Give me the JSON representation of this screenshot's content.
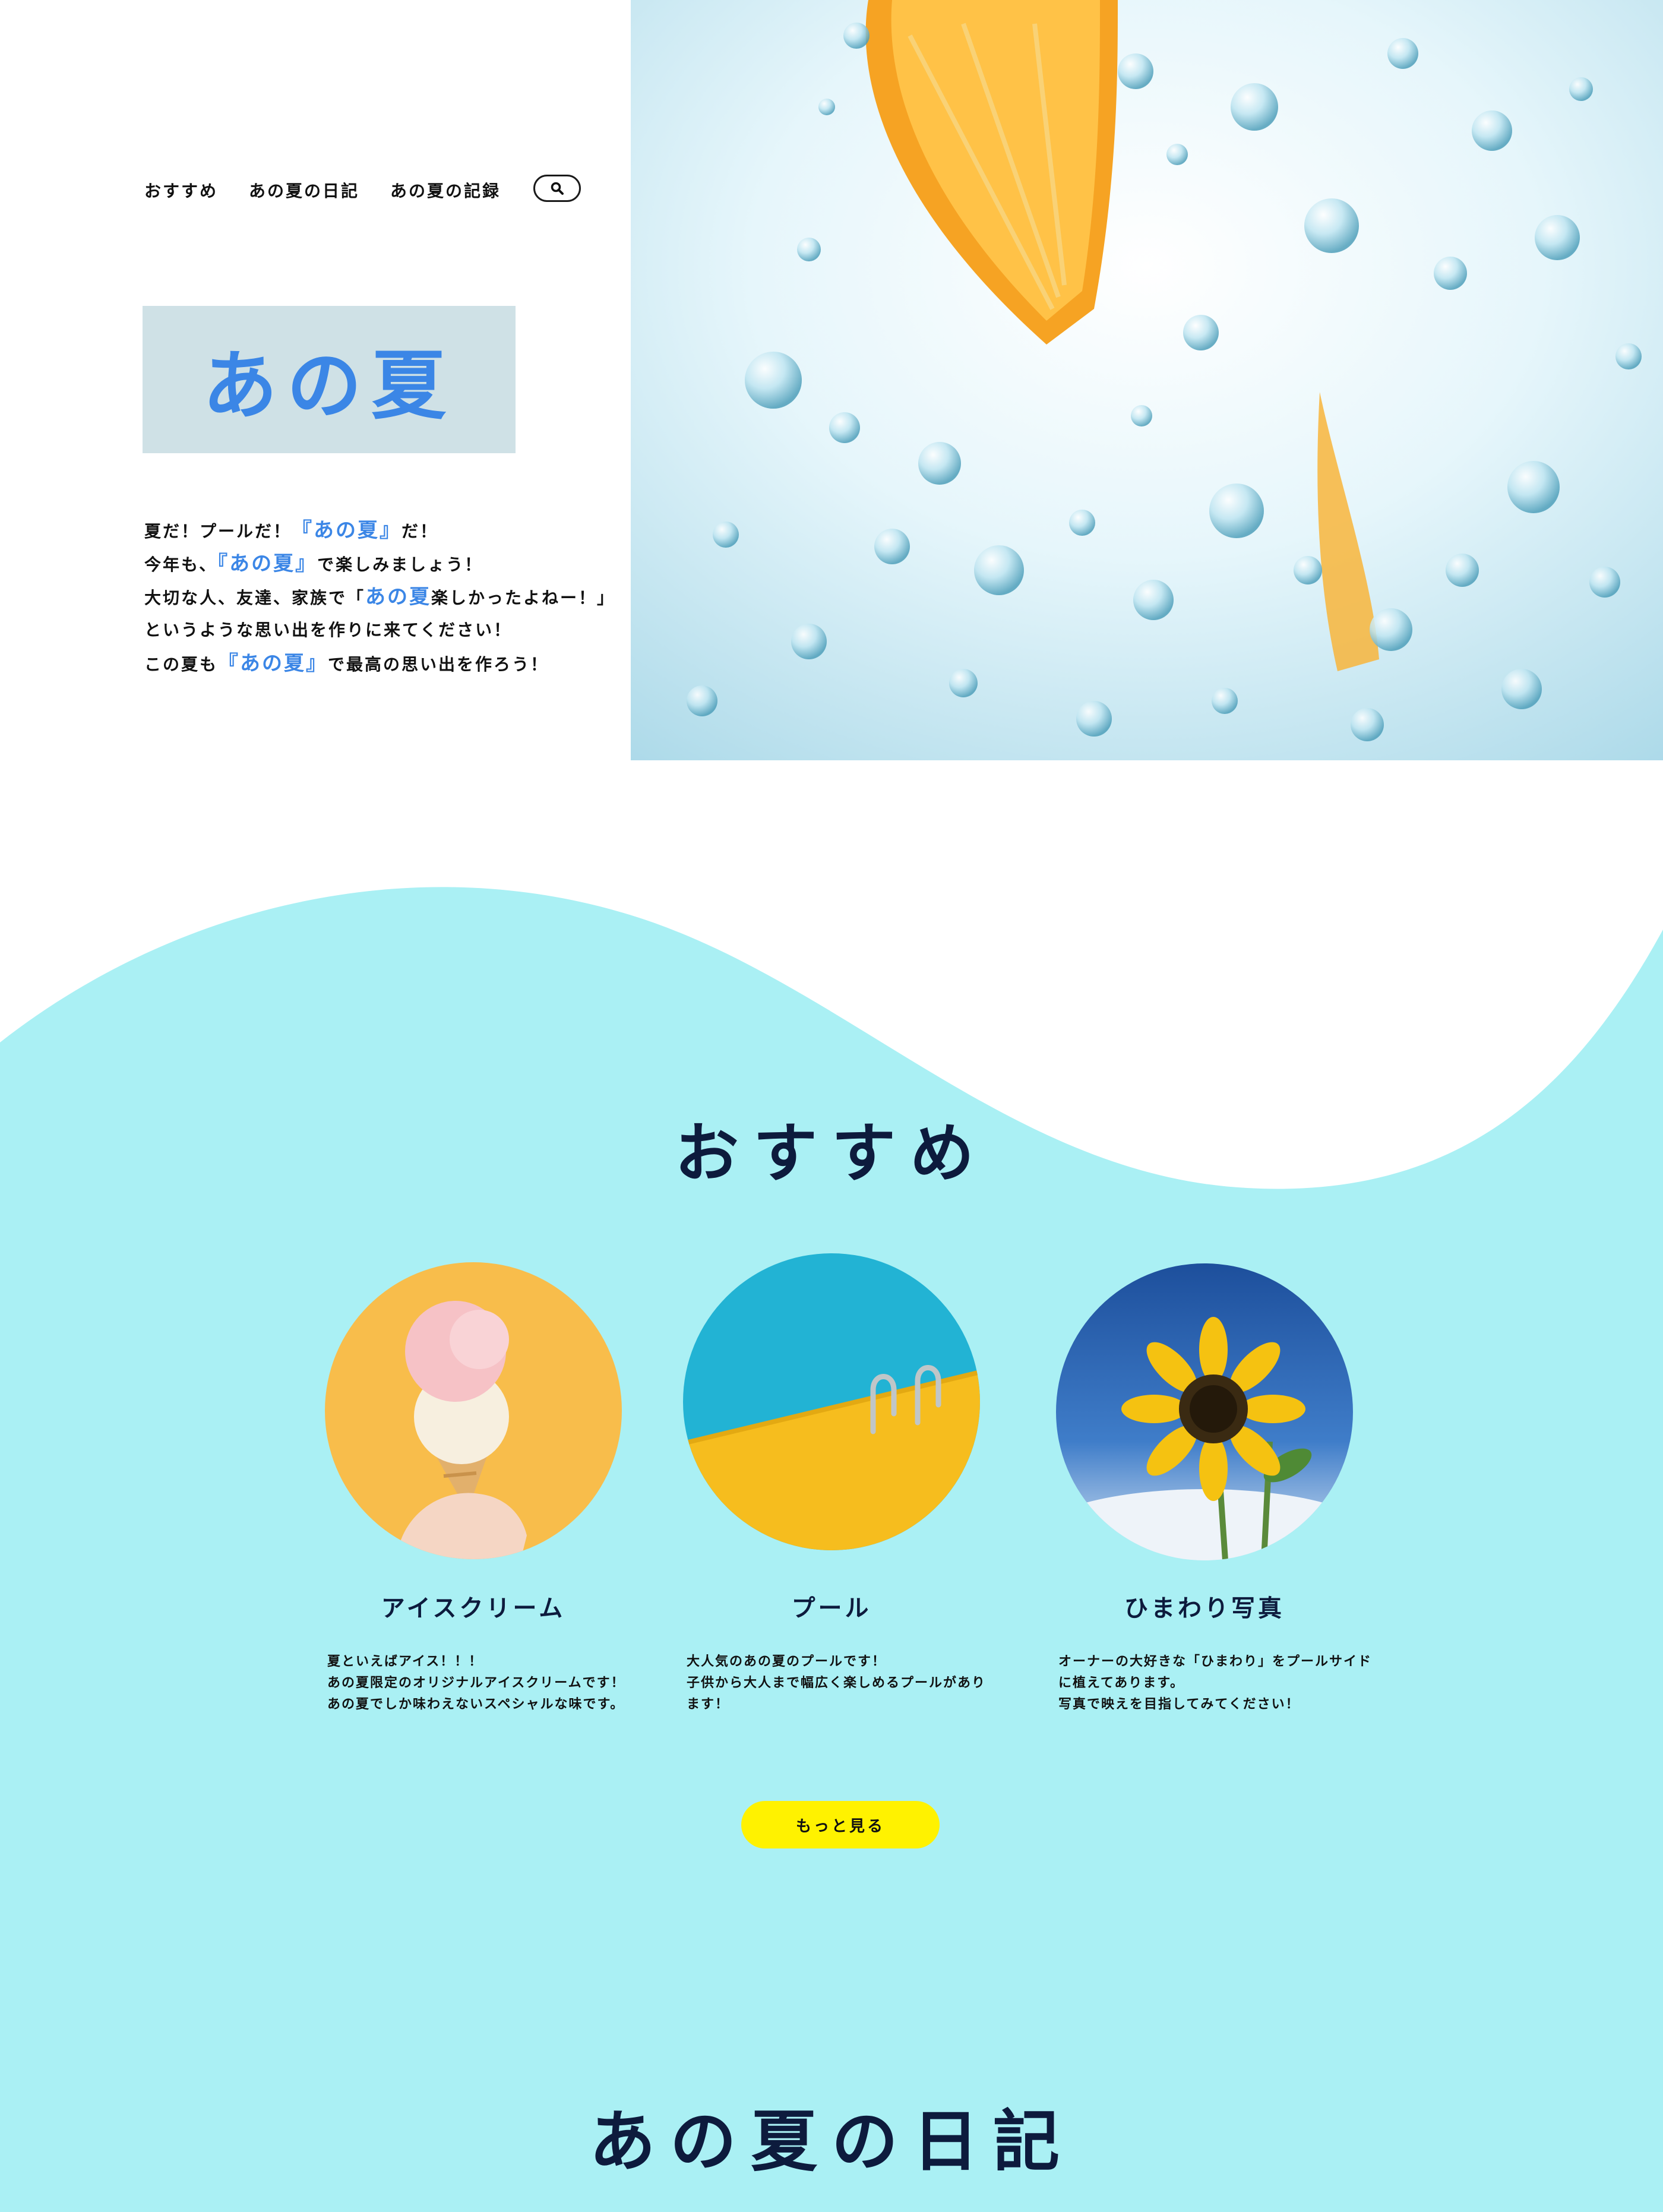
{
  "nav": {
    "items": [
      "おすすめ",
      "あの夏の日記",
      "あの夏の記録"
    ],
    "search_icon": "search-icon"
  },
  "logo": {
    "text": "あの夏"
  },
  "intro": {
    "line1_a": "夏だ！プールだ！",
    "line1_hl": "『あの夏』",
    "line1_b": "だ！",
    "line2_a": "今年も、",
    "line2_hl": "『あの夏』",
    "line2_b": "で楽しみましょう！",
    "line3_a": "大切な人、友達、家族で「",
    "line3_hl": "あの夏",
    "line3_b": "楽しかったよねー！」",
    "line4": "というような思い出を作りに来てください！",
    "line5_a": "この夏も",
    "line5_hl": "『あの夏』",
    "line5_b": "で最高の思い出を作ろう！"
  },
  "recommend": {
    "title": "おすすめ",
    "cards": [
      {
        "title": "アイスクリーム",
        "lines": [
          "夏といえばアイス！！！",
          "あの夏限定のオリジナルアイスクリームです！",
          "あの夏でしか味わえないスペシャルな味です。"
        ]
      },
      {
        "title": "プール",
        "lines": [
          "大人気のあの夏のプールです！",
          "子供から大人まで幅広く楽しめるプールがあり",
          "ます！"
        ]
      },
      {
        "title": "ひまわり写真",
        "lines": [
          "オーナーの大好きな「ひまわり」をプールサイド",
          "に植えてあります。",
          "写真で映えを目指してみてください！"
        ]
      }
    ],
    "more_button": "もっと見る"
  },
  "diary": {
    "title": "あの夏の日記"
  },
  "colors": {
    "section_bg": "#aaf0f4",
    "accent_blue": "#3b86e6",
    "navy": "#0d1b3d",
    "button_yellow": "#fff200",
    "logo_bg": "#cfe1e6"
  }
}
